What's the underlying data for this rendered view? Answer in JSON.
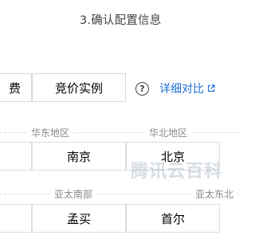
{
  "step_title": "3.确认配置信息",
  "billing": {
    "prev_option_label": "费",
    "spot_instance_label": "竞价实例"
  },
  "help_icon_glyph": "?",
  "compare_link": {
    "label": "详细对比",
    "color": "#1f6fd6"
  },
  "regions": {
    "east_china": "华东地区",
    "north_china": "华北地区",
    "asia_pacific_south": "亚太南部",
    "asia_pacific_northeast": "亚太东北"
  },
  "cities": {
    "nanjing": "南京",
    "beijing": "北京",
    "mumbai": "孟买",
    "seoul": "首尔"
  },
  "watermark": "腾讯云百科"
}
